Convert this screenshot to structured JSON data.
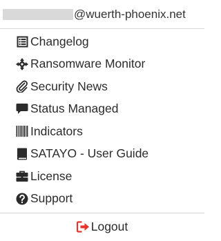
{
  "header": {
    "email_domain": "@wuerth-phoenix.net"
  },
  "menu": {
    "items": [
      {
        "label": "Changelog",
        "icon": "list-alt-icon"
      },
      {
        "label": "Ransomware Monitor",
        "icon": "crosshairs-icon"
      },
      {
        "label": "Security News",
        "icon": "paperclip-icon"
      },
      {
        "label": "Status Managed",
        "icon": "comment-icon"
      },
      {
        "label": "Indicators",
        "icon": "barcode-icon"
      },
      {
        "label": "SATAYO - User Guide",
        "icon": "book-icon"
      },
      {
        "label": "License",
        "icon": "briefcase-icon"
      },
      {
        "label": "Support",
        "icon": "question-circle-icon"
      }
    ],
    "logout": {
      "label": "Logout",
      "icon": "sign-out-icon",
      "icon_color": "#e8322c"
    }
  },
  "colors": {
    "text": "#2b2b2b",
    "divider": "#d6d6d6",
    "logout_icon": "#e8322c"
  }
}
